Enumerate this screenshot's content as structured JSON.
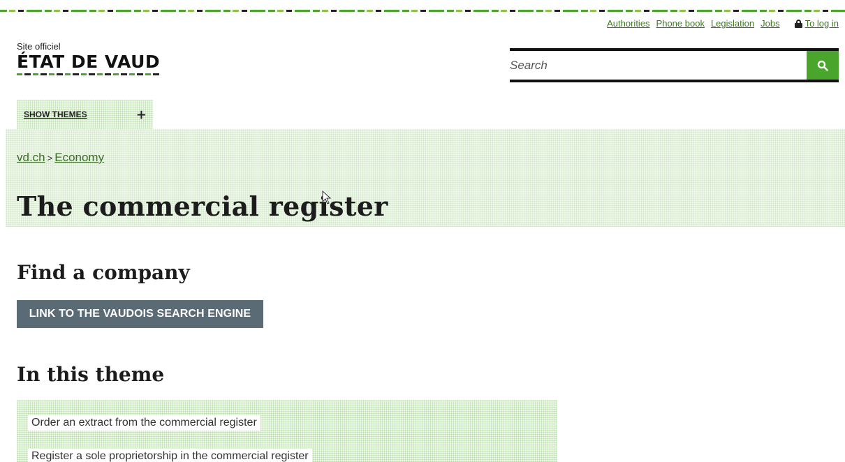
{
  "utility_nav": {
    "links": [
      "Authorities",
      "Phone book",
      "Legislation",
      "Jobs"
    ],
    "login_label": "To log in",
    "login_icon": "lock-icon"
  },
  "logo": {
    "small_text": "Site officiel",
    "big_text": "ÉTAT DE VAUD"
  },
  "search": {
    "placeholder": "Search",
    "button_icon": "search-icon",
    "accent_color": "#49a52b"
  },
  "themes_tab": {
    "label": "SHOW THEMES",
    "icon": "plus-icon"
  },
  "breadcrumb": {
    "items": [
      "vd.ch",
      "Economy"
    ],
    "separator": ">"
  },
  "page": {
    "title": "The commercial register"
  },
  "find_company": {
    "heading": "Find a company",
    "button_label": "LINK TO THE VAUDOIS SEARCH ENGINE"
  },
  "in_theme": {
    "heading": "In this theme",
    "links": [
      "Order an extract from the commercial register",
      "Register a sole proprietorship in the commercial register"
    ]
  }
}
